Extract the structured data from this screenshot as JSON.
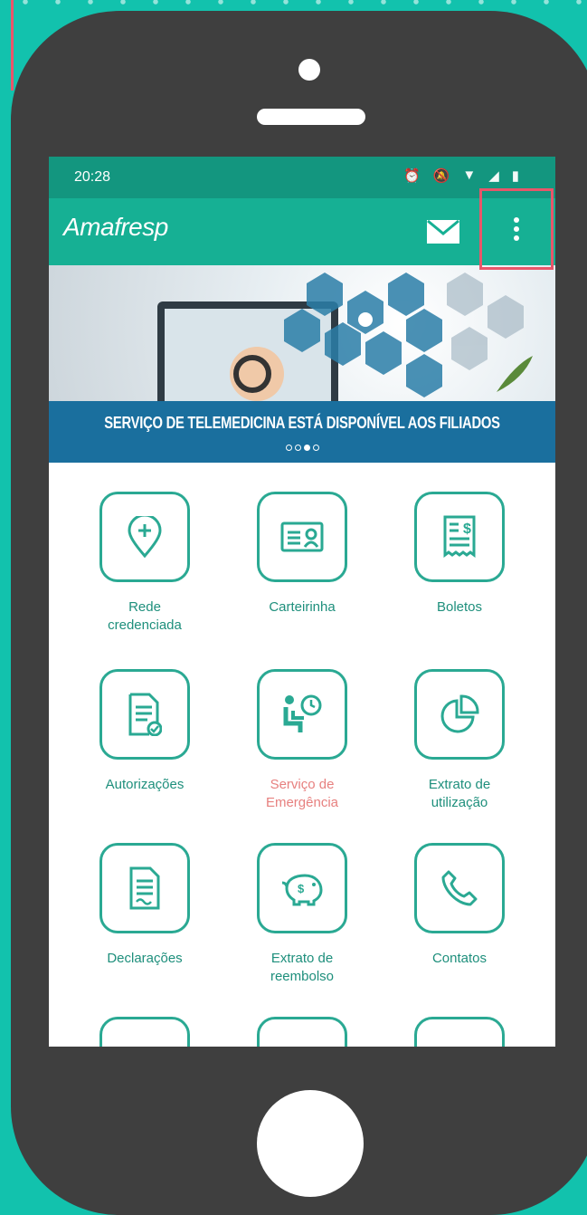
{
  "status_bar": {
    "time": "20:28",
    "icons": [
      "alarm-icon",
      "mute-icon",
      "wifi-icon",
      "signal-icon",
      "battery-icon"
    ]
  },
  "app_bar": {
    "logo": "Amafresp",
    "icons": [
      "mail-icon",
      "more-vert-icon"
    ]
  },
  "banner": {
    "caption": "SERVIÇO DE TELEMEDICINA ESTÁ DISPONÍVEL AOS FILIADOS",
    "page_count": 4,
    "active_page": 3
  },
  "menu": [
    {
      "label": "Rede\ncredenciada",
      "icon": "location-plus-icon"
    },
    {
      "label": "Carteirinha",
      "icon": "id-card-icon"
    },
    {
      "label": "Boletos",
      "icon": "receipt-icon"
    },
    {
      "label": "Autorizações",
      "icon": "document-check-icon"
    },
    {
      "label": "Serviço de\nEmergência",
      "icon": "emergency-seat-icon"
    },
    {
      "label": "Extrato de\nutilização",
      "icon": "pie-chart-icon"
    },
    {
      "label": "Declarações",
      "icon": "document-icon"
    },
    {
      "label": "Extrato de\nreembolso",
      "icon": "piggy-bank-icon"
    },
    {
      "label": "Contatos",
      "icon": "phone-icon"
    }
  ],
  "colors": {
    "background": "#12c2ad",
    "phone_body": "#3f3f3f",
    "status_bar": "#13967f",
    "app_bar": "#16b094",
    "banner_caption": "#1a6f9e",
    "accent": "#2aa993",
    "highlight": "#e8566a",
    "emergency_label": "#e7807f"
  }
}
